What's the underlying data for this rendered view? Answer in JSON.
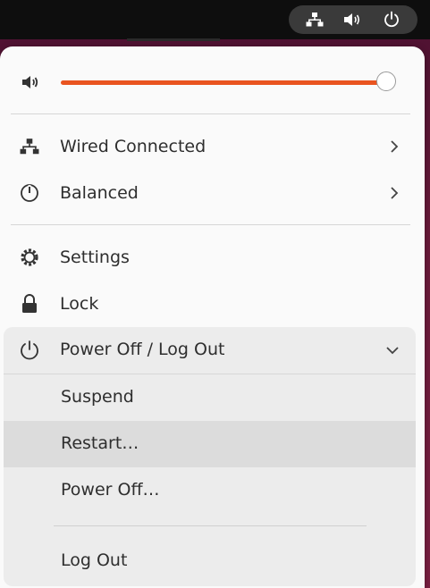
{
  "tray": {
    "icons": [
      "network-wired-icon",
      "volume-icon",
      "power-icon"
    ]
  },
  "volume": {
    "level": 1.0
  },
  "items": {
    "network": {
      "label": "Wired Connected"
    },
    "power_mode": {
      "label": "Balanced"
    },
    "settings": {
      "label": "Settings"
    },
    "lock": {
      "label": "Lock"
    }
  },
  "power_menu": {
    "header": "Power Off / Log Out",
    "expanded": true,
    "options": [
      {
        "label": "Suspend"
      },
      {
        "label": "Restart…"
      },
      {
        "label": "Power Off…"
      },
      {
        "label": "Log Out"
      }
    ]
  },
  "colors": {
    "accent": "#e95420",
    "panel_bg": "#fafafa",
    "submenu_bg": "#ececec",
    "hover_bg": "#dcdcdc"
  }
}
